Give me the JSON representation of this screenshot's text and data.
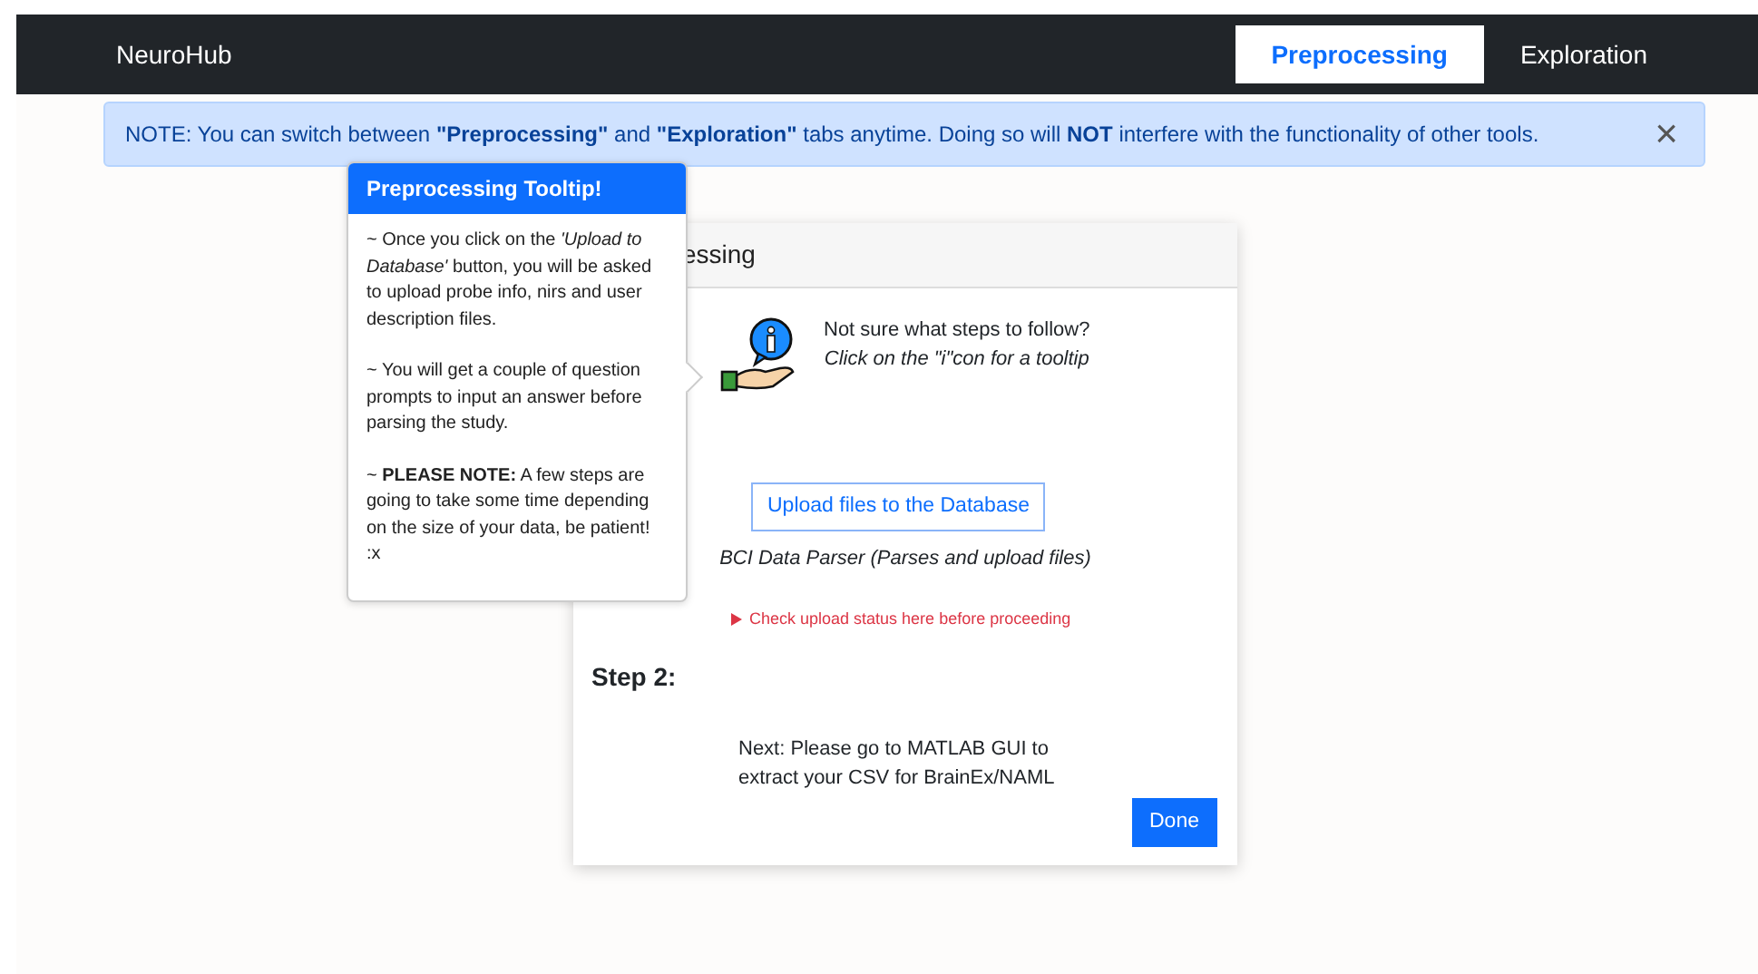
{
  "navbar": {
    "brand": "NeuroHub",
    "tabs": [
      {
        "label": "Preprocessing",
        "selected": true
      },
      {
        "label": "Exploration",
        "selected": false
      }
    ]
  },
  "alert": {
    "text": "NOTE: You can switch between **\"Preprocessing\"** and **\"Exploration\"** tabs anytime. Doing so will **NOT** interfere with the functionality of other tools.",
    "close": "×"
  },
  "tooltip": {
    "title": "Preprocessing Tooltip!",
    "paragraphs": [
      "~ Once you click on the *'Upload to Database'* button, you will be asked to upload probe info, nirs and user description files.",
      "~ You will get a couple of question prompts to input an answer before parsing the study.",
      "~ **PLEASE NOTE:** A few steps are going to take some time depending on the size of your data, be patient! :x"
    ]
  },
  "card": {
    "header": "essing",
    "hint": [
      "Not sure what steps to follow?",
      "Click on the \"i\"con for a tooltip"
    ],
    "upload_button": "Upload files to the Database",
    "caption": "BCI Data Parser (Parses and upload files)",
    "status_link": "Check upload status here before proceeding",
    "step_title": "Step 2:",
    "next_text": "Next: Please go to MATLAB GUI to extract your CSV for BrainEx/NAML",
    "done_button": "Done"
  }
}
